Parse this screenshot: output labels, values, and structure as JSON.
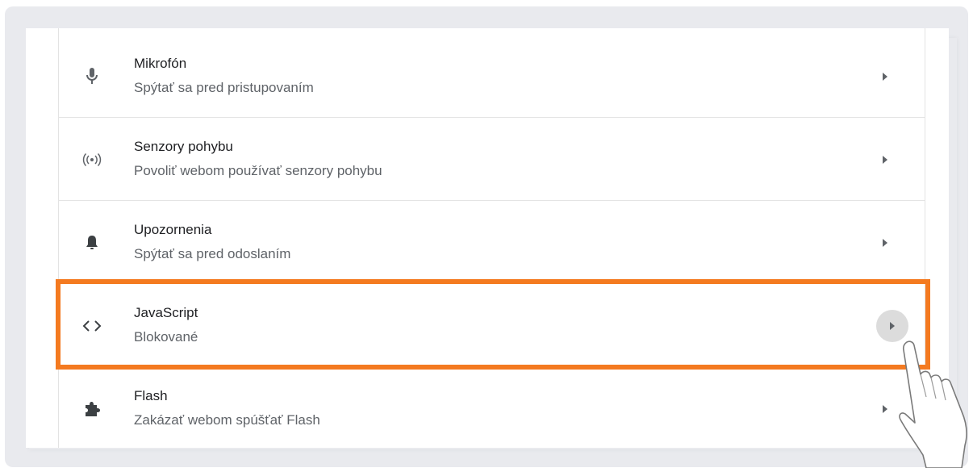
{
  "rows": [
    {
      "title": "Mikrofón",
      "subtitle": "Spýtať sa pred pristupovaním",
      "icon": "microphone-icon"
    },
    {
      "title": "Senzory pohybu",
      "subtitle": "Povoliť webom používať senzory pohybu",
      "icon": "sensors-icon"
    },
    {
      "title": "Upozornenia",
      "subtitle": "Spýtať sa pred odoslaním",
      "icon": "bell-icon"
    },
    {
      "title": "JavaScript",
      "subtitle": "Blokované",
      "icon": "code-icon"
    },
    {
      "title": "Flash",
      "subtitle": "Zakázať webom spúšťať Flash",
      "icon": "puzzle-icon"
    }
  ],
  "colors": {
    "highlight": "#f47a20",
    "text_primary": "#202124",
    "text_secondary": "#5f6368",
    "background": "#e9eaee"
  }
}
